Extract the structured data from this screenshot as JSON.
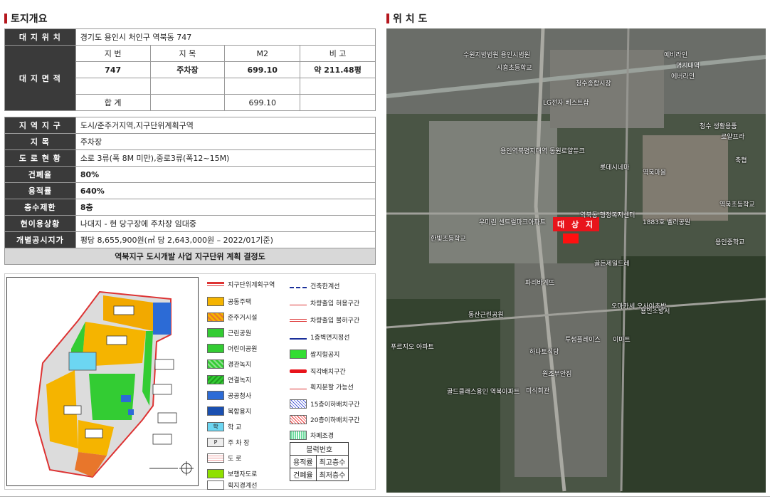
{
  "left_title": "토지개요",
  "right_title": "위 치 도",
  "site": {
    "loc_label": "대 지 위 치",
    "loc_value": "경기도 용인시 처인구 역북동 747",
    "area_label": "대 지 면 적",
    "cols": [
      "지 번",
      "지 목",
      "M2",
      "비 고"
    ],
    "row": [
      "747",
      "주차장",
      "699.10",
      "약 211.48평"
    ],
    "total_label": "합 계",
    "total_value": "699.10"
  },
  "zone": {
    "rows": [
      {
        "label": "지 역 지 구",
        "value": "도시/준주거지역,지구단위계획구역"
      },
      {
        "label": "지 목",
        "value": "주차장"
      },
      {
        "label": "도 로 현 황",
        "value": "소로 3류(폭 8M 미만),중로3류(폭12~15M)"
      },
      {
        "label": "건폐율",
        "value": "80%"
      },
      {
        "label": "용적률",
        "value": "640%"
      },
      {
        "label": "층수제한",
        "value": "8층"
      },
      {
        "label": "현이용상황",
        "value": "나대지 - 현 당구장에 주차장 임대중"
      },
      {
        "label": "개별공시지가",
        "value": "평당 8,655,900원(㎡ 당 2,643,000원 – 2022/01기준)"
      }
    ],
    "plan_caption": "역북지구 도시개발 사업 지구단위 계획 결정도"
  },
  "legend": {
    "left": [
      "지구단위계획구역",
      "공동주택",
      "준주거시설",
      "근린공원",
      "어린이공원",
      "경관녹지",
      "연결녹지",
      "공공청사",
      "복합용지",
      "학 교",
      "주 차 장",
      "도 로",
      "보행자도로",
      "획지경계선"
    ],
    "right": [
      "건축한계선",
      "차량출입 허용구간",
      "차량출입 불허구간",
      "1층벽면지정선",
      "쌈지형공지",
      "직각배치구간",
      "획지분할 가능선",
      "15층이하배치구간",
      "20층이하배치구간",
      "차폐조경"
    ],
    "school_mark": "학",
    "parking_mark": "P",
    "block_key": {
      "title": "블럭번호",
      "c1": "용적률",
      "c2": "최고층수",
      "c3": "건폐율",
      "c4": "최저층수"
    }
  },
  "map": {
    "target": "대 상 지",
    "labels": [
      "예비라인",
      "명지대역",
      "수원지방법원 용인시법원",
      "시흥초등학교",
      "청수종합시장",
      "LG전자 베스트샵",
      "용인역북명지대역 동원로얄듀크",
      "롯데시네마",
      "역북마을",
      "역북초등학교",
      "로얄프라",
      "역북동 행정복지센터",
      "우미린 센트럴파크아파트",
      "한빛초등학교",
      "파리바게뜨",
      "동산근린공원",
      "골든제일드레",
      "오마카세 오사이초밥",
      "용인소방서",
      "용인중학교",
      "투썸플레이스",
      "이마트",
      "하나토식당",
      "원조부안집",
      "골드클래스용인 역북아파트",
      "미식회관",
      "에버라인",
      "푸르지오 아파트",
      "1883호 벨러공원",
      "축협",
      "청수 생활용품"
    ]
  }
}
